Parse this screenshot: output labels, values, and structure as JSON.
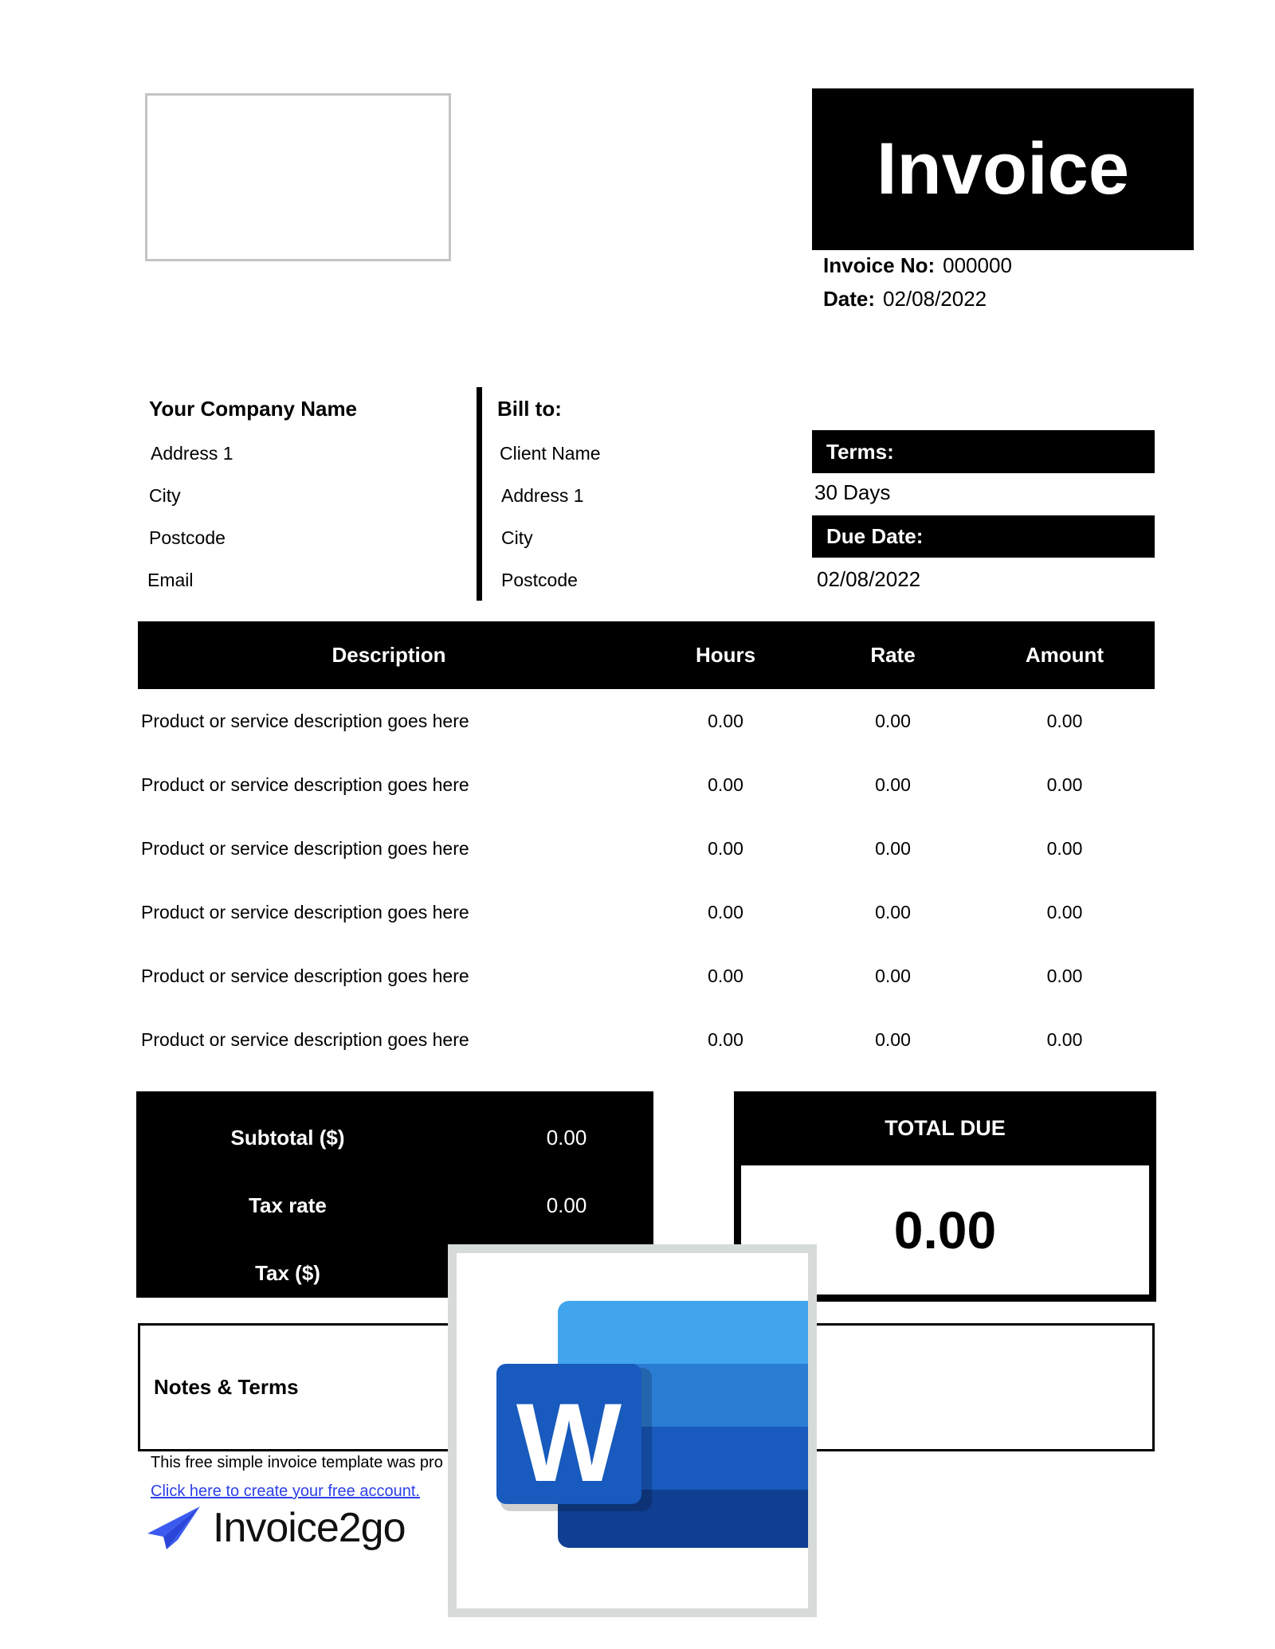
{
  "header": {
    "logo_placeholder": "",
    "title": "Invoice",
    "invoice_no_label": "Invoice No:",
    "invoice_no_value": "000000",
    "date_label": "Date:",
    "date_value": "02/08/2022"
  },
  "from": {
    "company_name": "Your Company Name",
    "lines": [
      "Address 1",
      "City",
      "Postcode",
      "Email"
    ]
  },
  "bill_to": {
    "label": "Bill to:",
    "lines": [
      "Client Name",
      "Address 1",
      "City",
      "Postcode"
    ]
  },
  "terms": {
    "terms_label": "Terms:",
    "terms_value": "30 Days",
    "due_date_label": "Due Date:",
    "due_date_value": "02/08/2022"
  },
  "items_table": {
    "columns": [
      "Description",
      "Hours",
      "Rate",
      "Amount"
    ],
    "rows": [
      {
        "description": "Product or service description goes here",
        "hours": "0.00",
        "rate": "0.00",
        "amount": "0.00"
      },
      {
        "description": "Product or service description goes here",
        "hours": "0.00",
        "rate": "0.00",
        "amount": "0.00"
      },
      {
        "description": "Product or service description goes here",
        "hours": "0.00",
        "rate": "0.00",
        "amount": "0.00"
      },
      {
        "description": "Product or service description goes here",
        "hours": "0.00",
        "rate": "0.00",
        "amount": "0.00"
      },
      {
        "description": "Product or service description goes here",
        "hours": "0.00",
        "rate": "0.00",
        "amount": "0.00"
      },
      {
        "description": "Product or service description goes here",
        "hours": "0.00",
        "rate": "0.00",
        "amount": "0.00"
      }
    ]
  },
  "summary": {
    "subtotal_label": "Subtotal ($)",
    "subtotal_value": "0.00",
    "tax_rate_label": "Tax rate",
    "tax_rate_value": "0.00",
    "tax_label": "Tax ($)"
  },
  "total": {
    "label": "TOTAL DUE",
    "value": "0.00"
  },
  "notes": {
    "label": "Notes & Terms"
  },
  "footer": {
    "text": "This free simple invoice template was pro",
    "link_text": "Click here to create your free account.",
    "brand_name": "Invoice2go",
    "brand_icon": "paper-plane-icon"
  },
  "overlay": {
    "icon": "microsoft-word-icon",
    "letter": "W"
  },
  "colors": {
    "primary": "#000000",
    "link": "#2b3fe6",
    "brand_blue": "#3b5bf0",
    "word_light": "#41a5ee",
    "word_mid": "#2b7cd3",
    "word_main": "#185abd",
    "word_dark": "#103f91",
    "frame_gray": "#d6dbda"
  }
}
